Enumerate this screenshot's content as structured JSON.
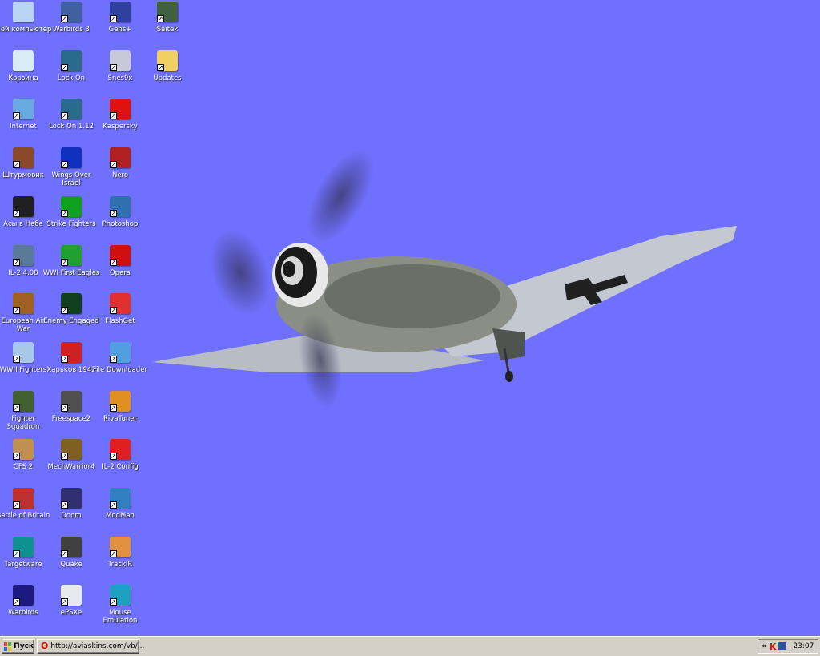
{
  "desktop": {
    "background_color": "#7070fe",
    "icons": [
      {
        "label": "Мой компьютер",
        "icon": "my-computer-icon",
        "color": "#b8d4f0",
        "shortcut": false
      },
      {
        "label": "Корзина",
        "icon": "recycle-bin-icon",
        "color": "#d8ecf4",
        "shortcut": false
      },
      {
        "label": "Internet",
        "icon": "network-icon",
        "color": "#6aa8e0",
        "shortcut": true
      },
      {
        "label": "Штурмовик",
        "icon": "il2-sturmovik-icon",
        "color": "#8a4a2a",
        "shortcut": true
      },
      {
        "label": "Асы в Небе",
        "icon": "aces-in-sky-icon",
        "color": "#202020",
        "shortcut": true
      },
      {
        "label": "IL-2 4.08",
        "icon": "il2-plane-icon",
        "color": "#5a7a9a",
        "shortcut": true
      },
      {
        "label": "European Air War",
        "icon": "european-air-war-icon",
        "color": "#a06020",
        "shortcut": true
      },
      {
        "label": "WWII Fighters",
        "icon": "wwii-fighters-icon",
        "color": "#a8c8e8",
        "shortcut": true
      },
      {
        "label": "Fighter Squadron",
        "icon": "fighter-squadron-icon",
        "color": "#406030",
        "shortcut": true
      },
      {
        "label": "CFS 2",
        "icon": "cfs2-icon",
        "color": "#c09050",
        "shortcut": true
      },
      {
        "label": "Battle of Britain",
        "icon": "battle-of-britain-icon",
        "color": "#c03030",
        "shortcut": true
      },
      {
        "label": "Targetware",
        "icon": "targetware-icon",
        "color": "#109090",
        "shortcut": true
      },
      {
        "label": "Warbirds",
        "icon": "warbirds-icon",
        "color": "#1a1a80",
        "shortcut": true
      },
      {
        "label": "Warbirds 3",
        "icon": "warbirds3-icon",
        "color": "#4060a0",
        "shortcut": true
      },
      {
        "label": "Lock On",
        "icon": "lock-on-icon",
        "color": "#2a6a8a",
        "shortcut": true
      },
      {
        "label": "Lock On 1.12",
        "icon": "lock-on-icon",
        "color": "#2a6a8a",
        "shortcut": true
      },
      {
        "label": "Wings Over Israel",
        "icon": "wings-over-israel-icon",
        "color": "#1030c0",
        "shortcut": true
      },
      {
        "label": "Strike Fighters",
        "icon": "strike-fighters-icon",
        "color": "#10a020",
        "shortcut": true
      },
      {
        "label": "WWI First Eagles",
        "icon": "first-eagles-icon",
        "color": "#20a030",
        "shortcut": true
      },
      {
        "label": "Enemy Engaged",
        "icon": "enemy-engaged-icon",
        "color": "#104020",
        "shortcut": true
      },
      {
        "label": "Харьков 1942",
        "icon": "kharkov-1942-icon",
        "color": "#d02020",
        "shortcut": true
      },
      {
        "label": "Freespace2",
        "icon": "freespace2-icon",
        "color": "#505050",
        "shortcut": true
      },
      {
        "label": "MechWarrior4",
        "icon": "mechwarrior4-icon",
        "color": "#806020",
        "shortcut": true
      },
      {
        "label": "Doom",
        "icon": "doom-icon",
        "color": "#303070",
        "shortcut": true
      },
      {
        "label": "Quake",
        "icon": "quake-icon",
        "color": "#404040",
        "shortcut": true
      },
      {
        "label": "ePSXe",
        "icon": "gamepad-icon",
        "color": "#e8e8f0",
        "shortcut": true
      },
      {
        "label": "Gens+",
        "icon": "gens-icon",
        "color": "#3040a0",
        "shortcut": true
      },
      {
        "label": "Snes9x",
        "icon": "snes-controller-icon",
        "color": "#c8c8d8",
        "shortcut": true
      },
      {
        "label": "Kaspersky",
        "icon": "kaspersky-icon",
        "color": "#e01010",
        "shortcut": true
      },
      {
        "label": "Nero",
        "icon": "nero-icon",
        "color": "#b02020",
        "shortcut": true
      },
      {
        "label": "Photoshop",
        "icon": "photoshop-icon",
        "color": "#3070b0",
        "shortcut": true
      },
      {
        "label": "Opera",
        "icon": "opera-icon",
        "color": "#d01010",
        "shortcut": true
      },
      {
        "label": "FlashGet",
        "icon": "flashget-icon",
        "color": "#e03030",
        "shortcut": true
      },
      {
        "label": "File Downloader",
        "icon": "file-downloader-icon",
        "color": "#50a0e0",
        "shortcut": true
      },
      {
        "label": "RivaTuner",
        "icon": "rivatuner-icon",
        "color": "#e09020",
        "shortcut": true
      },
      {
        "label": "IL-2 Config",
        "icon": "il2-config-icon",
        "color": "#e02020",
        "shortcut": true
      },
      {
        "label": "ModMan",
        "icon": "modman-icon",
        "color": "#3080c0",
        "shortcut": true
      },
      {
        "label": "TrackIR",
        "icon": "trackir-icon",
        "color": "#e09040",
        "shortcut": true
      },
      {
        "label": "Mouse Emulation",
        "icon": "crosshair-icon",
        "color": "#20a0c0",
        "shortcut": true
      },
      {
        "label": "Saitek",
        "icon": "saitek-joystick-icon",
        "color": "#406040",
        "shortcut": true
      },
      {
        "label": "Updates",
        "icon": "folder-icon",
        "color": "#f0d060",
        "shortcut": true
      }
    ]
  },
  "taskbar": {
    "start_label": "Пуск",
    "task_label": "http://aviaskins.com/vb/...",
    "tray_expand": "«",
    "clock": "23:07"
  }
}
